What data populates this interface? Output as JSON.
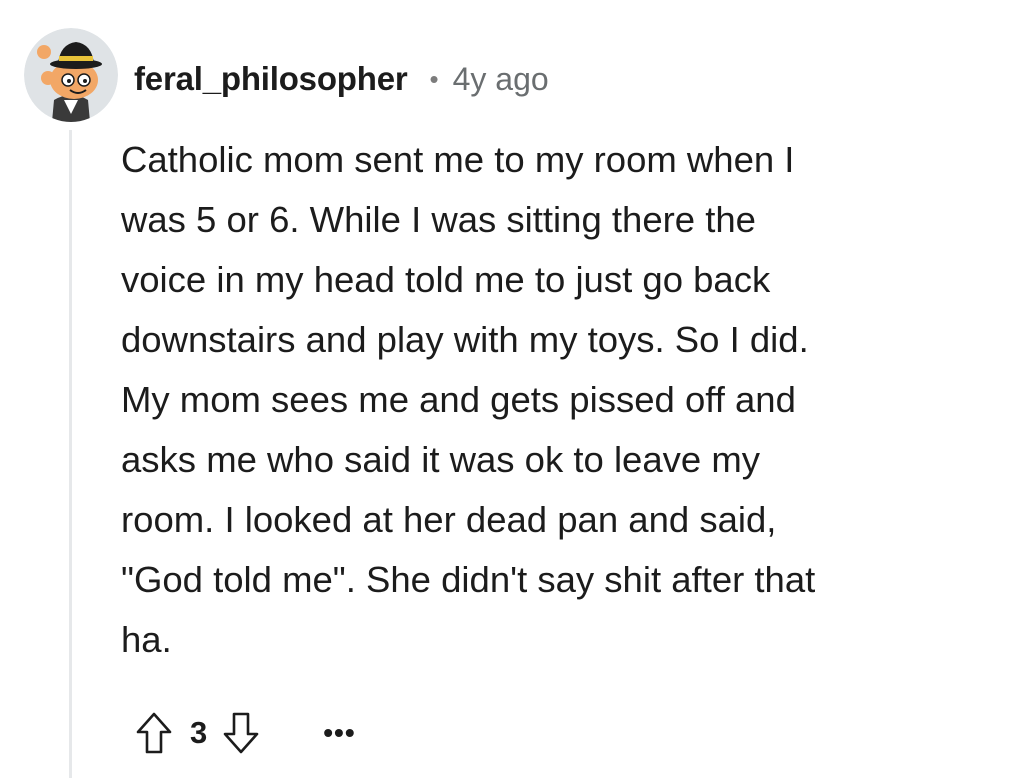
{
  "comment": {
    "username": "feral_philosopher",
    "separator": "•",
    "timestamp": "4y ago",
    "avatar_icon": "snoo-avatar-icon",
    "body_lines": [
      "Catholic mom sent me to my room when I",
      "was 5 or 6. While I was sitting there the",
      "voice in my head told me to just go back",
      "downstairs and play with my toys. So I did.",
      "My mom sees me and gets pissed off and",
      "asks me who said it was ok to leave my",
      "room. I looked at her dead pan and said,",
      "\"God told me\". She didn't say shit after that",
      "ha."
    ],
    "actions": {
      "upvote_icon": "upvote-arrow-icon",
      "score": "3",
      "downvote_icon": "downvote-arrow-icon",
      "more_label": "•••"
    }
  },
  "colors": {
    "text": "#1c1c1c",
    "meta": "#6a6e70",
    "thread_line": "#e6e8ea",
    "background": "#ffffff"
  }
}
